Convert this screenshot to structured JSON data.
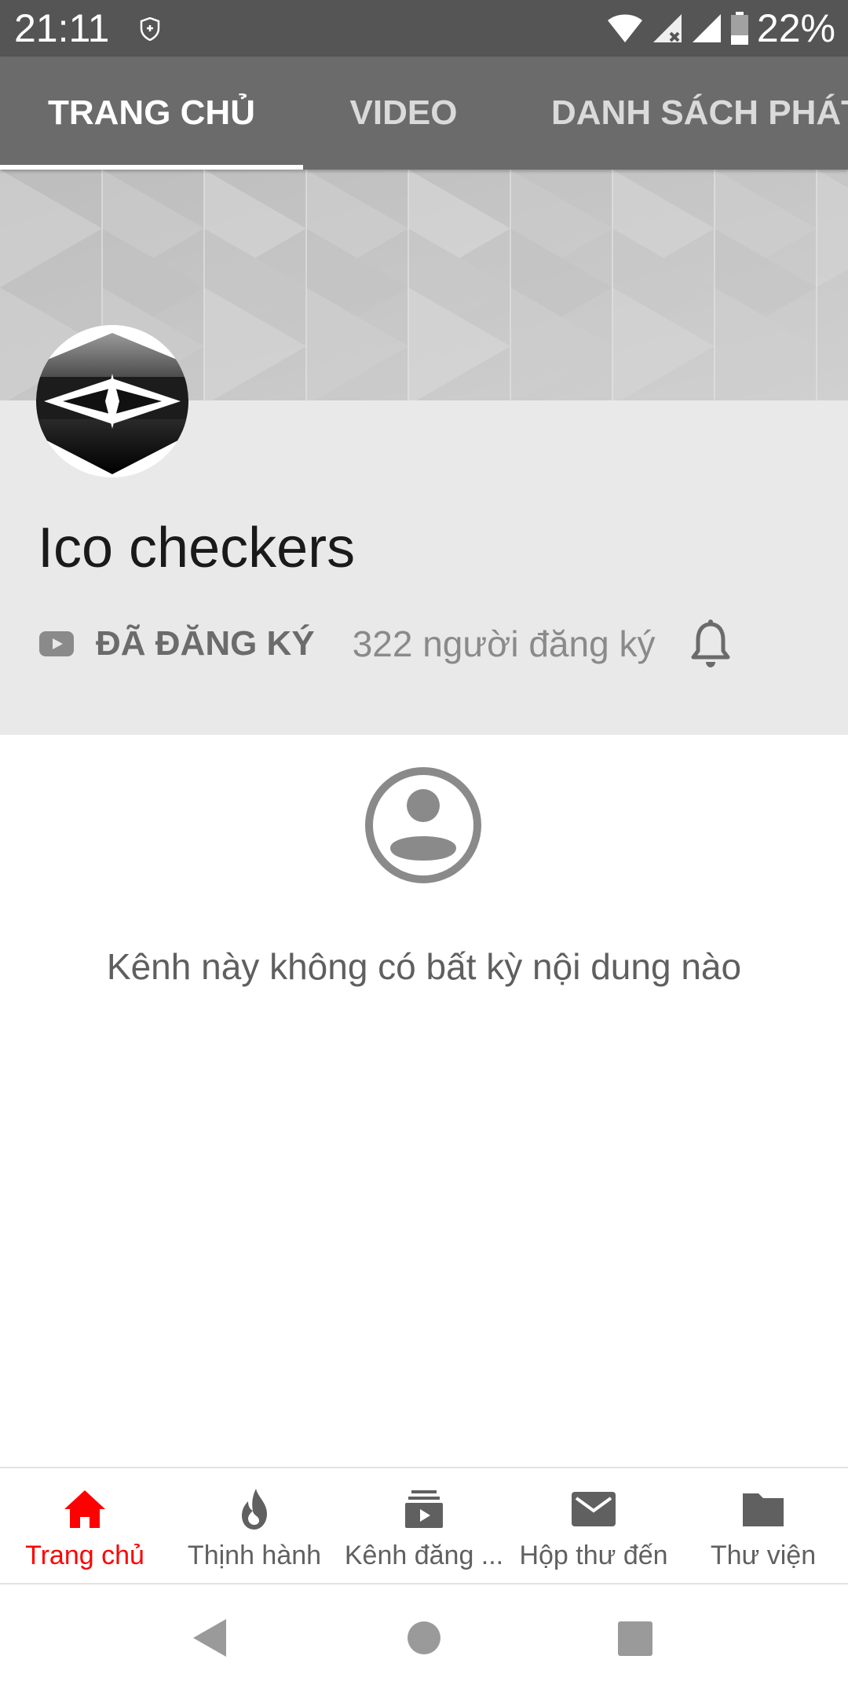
{
  "status_bar": {
    "time": "21:11",
    "battery_percent": "22%",
    "icons": [
      "shield-icon",
      "wifi-icon",
      "signal-no-data-icon",
      "signal-icon",
      "battery-icon"
    ]
  },
  "tabs": [
    {
      "label": "TRANG CHỦ",
      "active": true
    },
    {
      "label": "VIDEO",
      "active": false
    },
    {
      "label": "DANH SÁCH PHÁT",
      "active": false
    }
  ],
  "channel": {
    "name": "Ico checkers",
    "subscribed_label": "ĐÃ ĐĂNG KÝ",
    "subscriber_count": "322 người đăng ký"
  },
  "empty_state": {
    "message": "Kênh này không có bất kỳ nội dung nào",
    "icon": "account-circle-icon"
  },
  "bottom_nav": [
    {
      "label": "Trang chủ",
      "icon": "home-icon",
      "active": true
    },
    {
      "label": "Thịnh hành",
      "icon": "trending-flame-icon",
      "active": false
    },
    {
      "label": "Kênh đăng ...",
      "icon": "subscriptions-icon",
      "active": false
    },
    {
      "label": "Hộp thư đến",
      "icon": "inbox-mail-icon",
      "active": false
    },
    {
      "label": "Thư viện",
      "icon": "library-folder-icon",
      "active": false
    }
  ],
  "system_nav": [
    "back-icon",
    "home-circle-icon",
    "recents-square-icon"
  ],
  "colors": {
    "accent_red": "#ff0000",
    "tab_bar": "#6b6b6b",
    "status_bar": "#555555",
    "header_bg": "#e9e9e9"
  }
}
